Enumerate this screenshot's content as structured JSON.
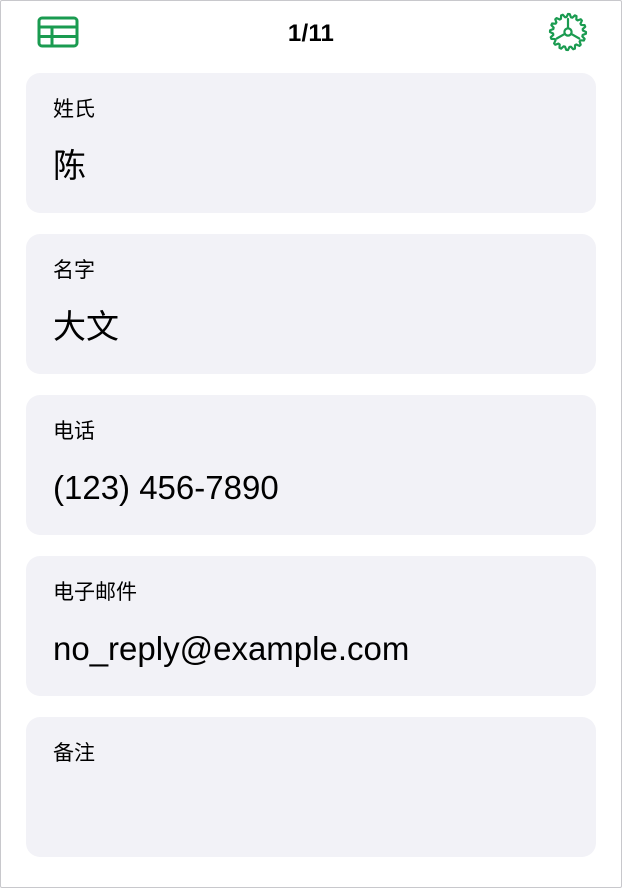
{
  "toolbar": {
    "record_counter": "1/11",
    "table_view_icon": "table-grid-icon",
    "settings_icon": "gear-icon",
    "accent_color": "#1a9b50"
  },
  "form": {
    "fields": [
      {
        "label": "姓氏",
        "value": "陈"
      },
      {
        "label": "名字",
        "value": "大文"
      },
      {
        "label": "电话",
        "value": "(123) 456-7890"
      },
      {
        "label": "电子邮件",
        "value": "no_reply@example.com"
      },
      {
        "label": "备注",
        "value": ""
      }
    ]
  },
  "colors": {
    "card_background": "#f2f2f7",
    "text": "#000000",
    "background": "#ffffff"
  }
}
